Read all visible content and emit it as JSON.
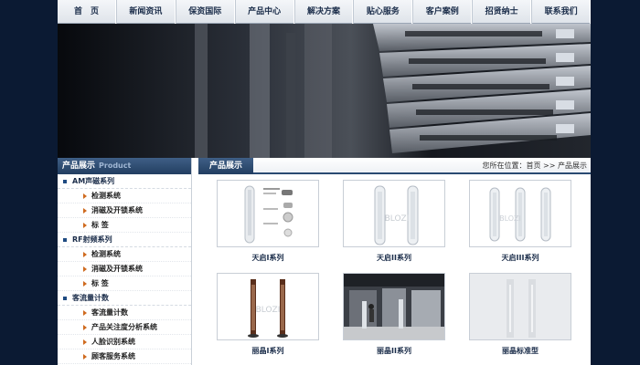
{
  "nav": {
    "items": [
      "首　页",
      "新闻资讯",
      "保资国际",
      "产品中心",
      "解决方案",
      "贴心服务",
      "客户案例",
      "招贤纳士",
      "联系我们"
    ]
  },
  "sidebar": {
    "title": "产品展示",
    "title_en": "Product",
    "groups": [
      {
        "label": "AM声磁系列",
        "items": [
          "检测系统",
          "消磁及开锁系统",
          "标  签"
        ]
      },
      {
        "label": "RF射频系列",
        "items": [
          "检测系统",
          "消磁及开锁系统",
          "标  签"
        ]
      },
      {
        "label": "客流量计数",
        "items": [
          "客流量计数",
          "产品关注度分析系统",
          "人脸识别系统",
          "顾客服务系统"
        ]
      }
    ]
  },
  "main": {
    "tab": "产品展示",
    "breadcrumb": {
      "prefix": "您所在位置：",
      "home": "首页",
      "sep": " >> ",
      "current": "产品展示"
    },
    "products": [
      {
        "name": "天启I系列",
        "watermark": ""
      },
      {
        "name": "天启II系列",
        "watermark": "BLOZI"
      },
      {
        "name": "天启III系列",
        "watermark": "BLOZI"
      },
      {
        "name": "丽晶I系列",
        "watermark": "BLOZI"
      },
      {
        "name": "丽晶II系列",
        "watermark": ""
      },
      {
        "name": "丽晶标准型",
        "watermark": ""
      }
    ]
  },
  "colors": {
    "page_bg": "#0b1a33",
    "accent": "#223e61",
    "arrow": "#cf6a1e"
  }
}
